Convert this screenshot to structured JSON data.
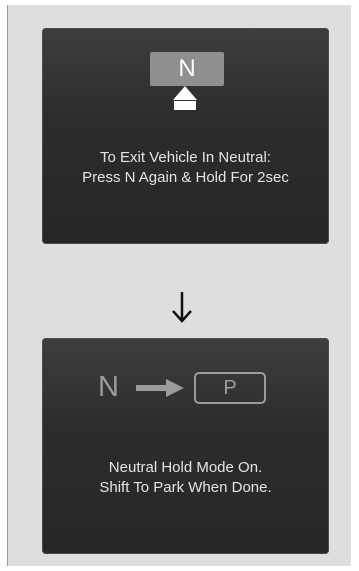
{
  "step1": {
    "gear_label": "N",
    "message_line1": "To Exit Vehicle In Neutral:",
    "message_line2": "Press N Again & Hold For 2sec"
  },
  "transition": {
    "arrow_icon": "arrow-down-icon"
  },
  "step2": {
    "from_gear": "N",
    "to_gear": "P",
    "message_line1": "Neutral Hold Mode On.",
    "message_line2": "Shift To Park When Done."
  },
  "colors": {
    "screen_bg": "#2d2d2d",
    "page_bg": "#dedede",
    "text": "#e4e4e4",
    "muted": "#9b9b9b"
  }
}
